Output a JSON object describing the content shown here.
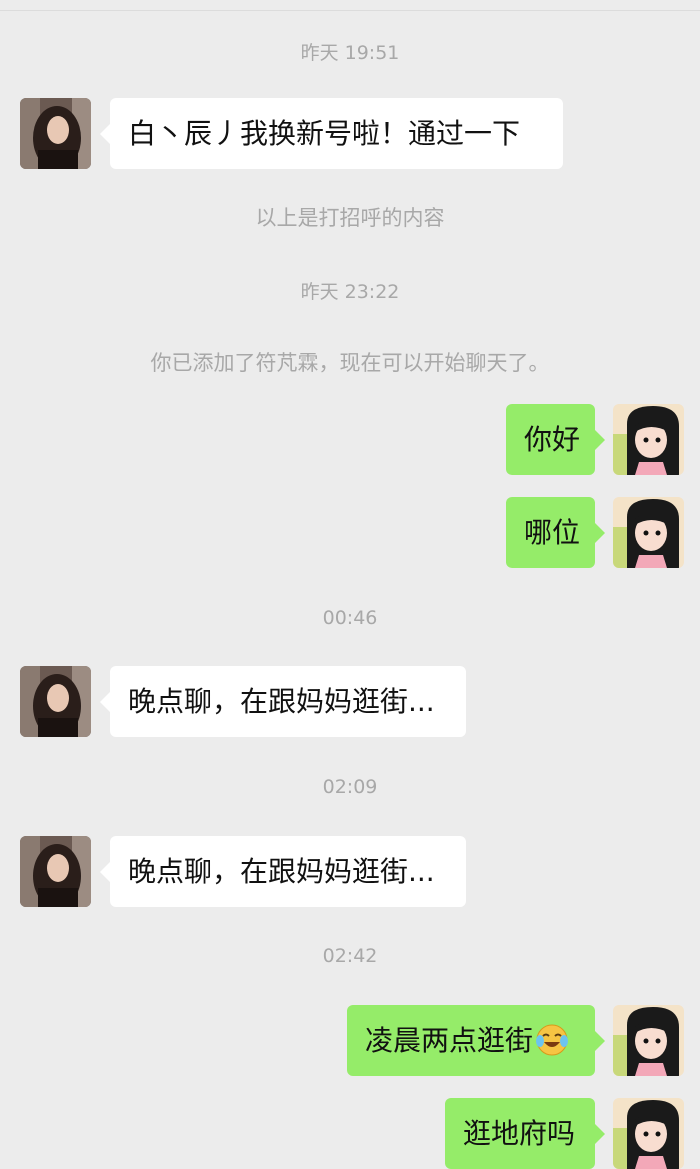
{
  "chat": {
    "messages": [
      {
        "type": "time",
        "text": "昨天 19:51"
      },
      {
        "type": "incoming",
        "text": "白丶辰丿我换新号啦！通过一下",
        "avatar_icon": "contact-avatar-photo"
      },
      {
        "type": "system",
        "text": "以上是打招呼的内容"
      },
      {
        "type": "time",
        "text": "昨天 23:22"
      },
      {
        "type": "system",
        "text": "你已添加了符芃霖，现在可以开始聊天了。"
      },
      {
        "type": "outgoing",
        "text": "你好",
        "avatar_icon": "self-avatar-cartoon"
      },
      {
        "type": "outgoing",
        "text": "哪位",
        "avatar_icon": "self-avatar-cartoon"
      },
      {
        "type": "time",
        "text": "00:46"
      },
      {
        "type": "incoming",
        "text": "晚点聊，在跟妈妈逛街...",
        "avatar_icon": "contact-avatar-photo"
      },
      {
        "type": "time",
        "text": "02:09"
      },
      {
        "type": "incoming",
        "text": "晚点聊，在跟妈妈逛街...",
        "avatar_icon": "contact-avatar-photo"
      },
      {
        "type": "time",
        "text": "02:42"
      },
      {
        "type": "outgoing",
        "text": "凌晨两点逛街",
        "emoji": "laughing-crying-emoji",
        "avatar_icon": "self-avatar-cartoon"
      },
      {
        "type": "outgoing",
        "text": "逛地府吗",
        "avatar_icon": "self-avatar-cartoon"
      }
    ]
  },
  "colors": {
    "background": "#ececec",
    "incoming_bubble": "#ffffff",
    "outgoing_bubble": "#95ec69",
    "timestamp_text": "#a8a8a8"
  }
}
